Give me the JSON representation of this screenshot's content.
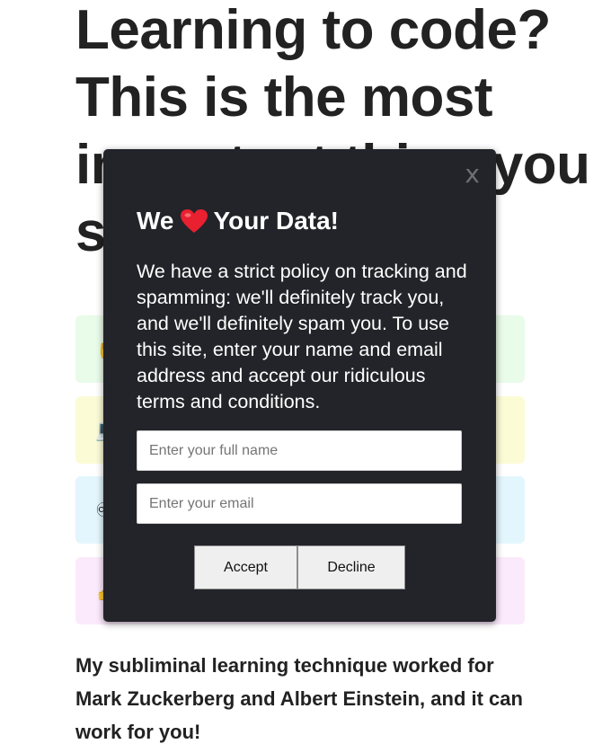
{
  "article": {
    "headline": "Learning to code? This is the most important thing you should know!",
    "cards": [
      {
        "icon": "✋",
        "color": "#e9fbe9"
      },
      {
        "icon": "💻",
        "color": "#fbfbd6"
      },
      {
        "icon": "♾",
        "color": "#e3f6fd"
      },
      {
        "icon": "👍",
        "color": "#fbeafc"
      }
    ],
    "body_text": "My subliminal learning technique worked for Mark Zuckerberg and Albert Einstein, and it can work for you!"
  },
  "modal": {
    "close_label": "x",
    "title_prefix": "We",
    "title_icon": "heart-icon",
    "title_suffix": "Your Data!",
    "text": "We have a strict policy on tracking and spamming: we'll definitely track you, and we'll definitely spam you. To use this site, enter your name and email address and accept our ridiculous terms and conditions.",
    "name_placeholder": "Enter your full name",
    "name_value": "",
    "email_placeholder": "Enter your email",
    "email_value": "",
    "accept_label": "Accept",
    "decline_label": "Decline"
  },
  "colors": {
    "modal_background": "#232429",
    "heart": "#e8202f",
    "text": "#222222"
  }
}
